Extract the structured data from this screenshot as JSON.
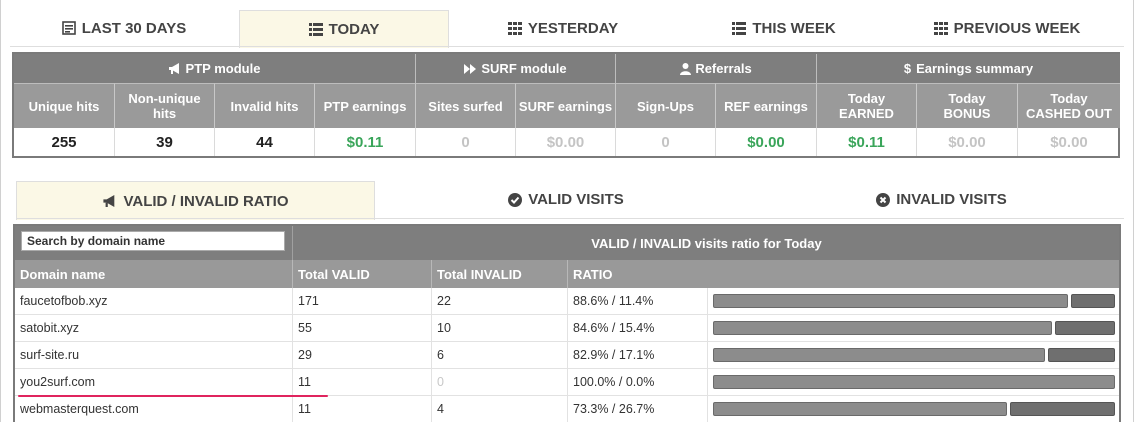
{
  "period_tabs": [
    {
      "label": "LAST 30 DAYS",
      "icon": "calendar-icon",
      "active": false
    },
    {
      "label": "TODAY",
      "icon": "list-icon",
      "active": true
    },
    {
      "label": "YESTERDAY",
      "icon": "grid-icon",
      "active": false
    },
    {
      "label": "THIS WEEK",
      "icon": "list-icon",
      "active": false
    },
    {
      "label": "PREVIOUS WEEK",
      "icon": "grid-icon",
      "active": false
    }
  ],
  "stats": {
    "groups": [
      {
        "label": "PTP module",
        "icon": "megaphone-icon"
      },
      {
        "label": "SURF module",
        "icon": "fast-forward-icon"
      },
      {
        "label": "Referrals",
        "icon": "user-icon"
      },
      {
        "label": "Earnings summary",
        "icon": "dollar-icon"
      }
    ],
    "headers": [
      [
        "Unique hits"
      ],
      [
        "Non-unique",
        "hits"
      ],
      [
        "Invalid hits"
      ],
      [
        "PTP earnings"
      ],
      [
        "Sites surfed"
      ],
      [
        "SURF earnings"
      ],
      [
        "Sign-Ups"
      ],
      [
        "REF earnings"
      ],
      [
        "Today",
        "EARNED"
      ],
      [
        "Today",
        "BONUS"
      ],
      [
        "Today",
        "CASHED OUT"
      ]
    ],
    "values": [
      "255",
      "39",
      "44",
      "$0.11",
      "0",
      "$0.00",
      "0",
      "$0.00",
      "$0.11",
      "$0.00",
      "$0.00"
    ],
    "value_colors": [
      "dark",
      "dark",
      "dark",
      "green",
      "grey",
      "grey",
      "grey",
      "green",
      "green",
      "grey",
      "grey"
    ]
  },
  "detail_tabs": [
    {
      "label": "VALID / INVALID RATIO",
      "icon": "megaphone-icon",
      "active": true
    },
    {
      "label": "VALID VISITS",
      "icon": "check-circle-icon",
      "active": false
    },
    {
      "label": "INVALID VISITS",
      "icon": "x-circle-icon",
      "active": false
    }
  ],
  "domain_table": {
    "search_placeholder": "Search by domain name",
    "title": "VALID / INVALID visits ratio for Today",
    "columns": [
      "Domain name",
      "Total VALID",
      "Total INVALID",
      "RATIO"
    ],
    "rows": [
      {
        "domain": "faucetofbob.xyz",
        "valid": "171",
        "invalid": "22",
        "ratio": "88.6% / 11.4%",
        "valid_pct": 88.6
      },
      {
        "domain": "satobit.xyz",
        "valid": "55",
        "invalid": "10",
        "ratio": "84.6% / 15.4%",
        "valid_pct": 84.6
      },
      {
        "domain": "surf-site.ru",
        "valid": "29",
        "invalid": "6",
        "ratio": "82.9% / 17.1%",
        "valid_pct": 82.9
      },
      {
        "domain": "you2surf.com",
        "valid": "11",
        "invalid": "0",
        "ratio": "100.0% / 0.0%",
        "valid_pct": 100.0
      },
      {
        "domain": "webmasterquest.com",
        "valid": "11",
        "invalid": "4",
        "ratio": "73.3% / 26.7%",
        "valid_pct": 73.3
      }
    ]
  },
  "colors": {
    "green": "#3aa55a",
    "invalid_red": "#d9534f",
    "highlight_underline": "#e0245e",
    "active_tab_bg": "#fbf8e6"
  }
}
